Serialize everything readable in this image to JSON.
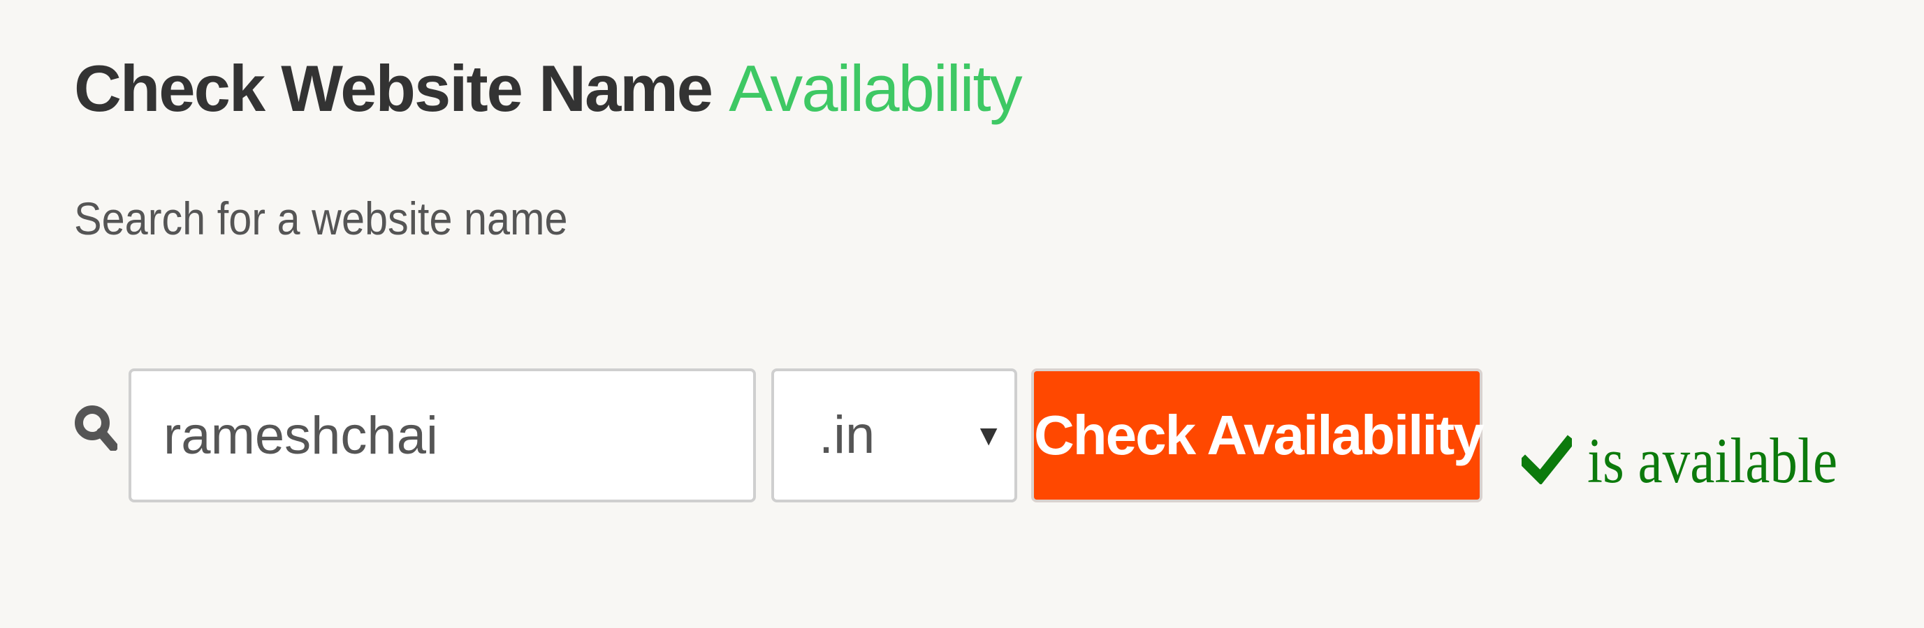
{
  "header": {
    "title_main": "Check Website Name",
    "title_accent": "Availability"
  },
  "subtitle": "Search for a website name",
  "search": {
    "icon": "search-icon",
    "value": "rameshchai",
    "tld_selected": ".in",
    "button_label": "Check Availability"
  },
  "result": {
    "icon": "checkmark-icon",
    "text": "is available"
  },
  "colors": {
    "title": "#333333",
    "accent": "#3ec864",
    "button": "#ff4800",
    "success": "#0c7a0c",
    "background": "#f8f7f4"
  }
}
